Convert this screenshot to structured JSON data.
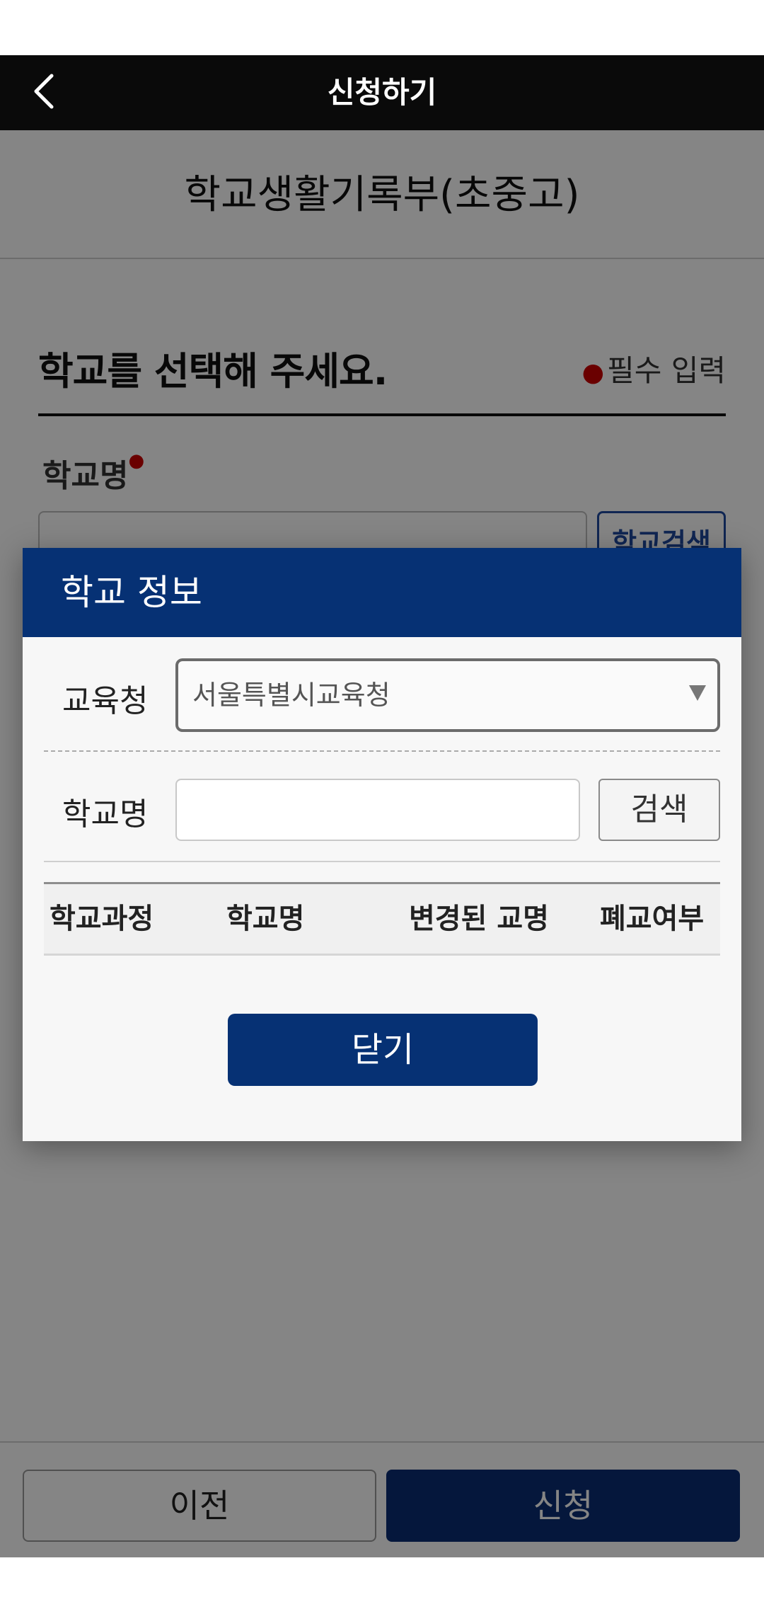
{
  "header": {
    "title": "신청하기"
  },
  "page": {
    "service_title": "학교생활기록부(초중고)",
    "section_heading": "학교를 선택해 주세요.",
    "required_note": "필수 입력",
    "school_name_label": "학교명",
    "school_search_button": "학교검색"
  },
  "bottom_bar": {
    "prev_label": "이전",
    "submit_label": "신청"
  },
  "modal": {
    "title": "학교 정보",
    "education_office_label": "교육청",
    "education_office_value": "서울특별시교육청",
    "school_name_label": "학교명",
    "school_name_value": "",
    "search_button": "검색",
    "table_headers": [
      "학교과정",
      "학교명",
      "변경된 교명",
      "폐교여부"
    ],
    "close_button": "닫기"
  },
  "colors": {
    "header_bg": "#0a0a0a",
    "modal_header_bg": "#063174",
    "primary_button": "#063174",
    "required_dot": "#cc0000"
  },
  "icons": {
    "back": "chevron-left-icon",
    "select_arrow": "triangle-down-icon"
  }
}
